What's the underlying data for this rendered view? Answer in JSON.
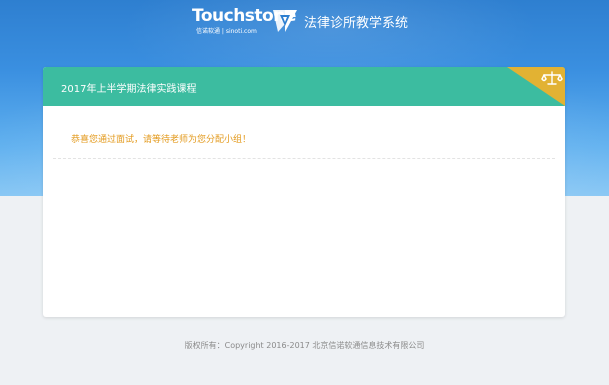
{
  "header": {
    "brand_name": "Touchstone",
    "brand_sub": "信诺软通 | sinoti.com",
    "system_title": "法律诊所教学系统"
  },
  "course": {
    "title": "2017年上半学期法律实践课程",
    "message": "恭喜您通过面试，请等待老师为您分配小组！"
  },
  "footer": {
    "copyright": "版权所有：Copyright 2016-2017 北京信诺软通信息技术有限公司"
  },
  "colors": {
    "header_bg": "#3a8fe0",
    "card_header": "#3cbca0",
    "corner_accent": "#e2b233",
    "message_text": "#e39a1d"
  },
  "icons": {
    "logo": "touchstone-logo-icon",
    "corner": "scales-of-justice-icon"
  }
}
